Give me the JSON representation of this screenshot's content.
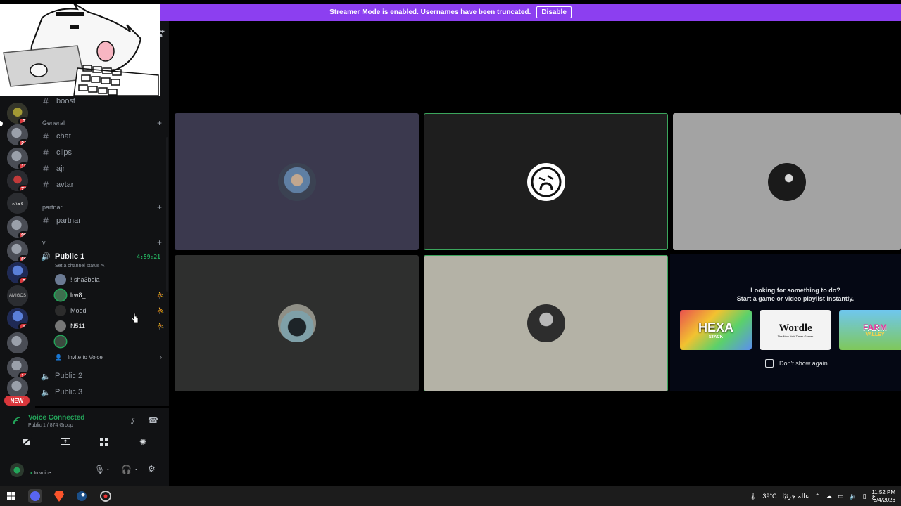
{
  "banner": {
    "text": "Streamer Mode is enabled. Usernames have been truncated.",
    "button": "Disable"
  },
  "servers": [
    {
      "badge": ""
    },
    {
      "badge": "2"
    },
    {
      "badge": "24"
    },
    {
      "badge": "11"
    },
    {
      "badge": "72"
    },
    {
      "badge": ""
    },
    {
      "badge": "95"
    },
    {
      "badge": "69"
    },
    {
      "badge": "7"
    },
    {
      "badge": ""
    },
    {
      "badge": "1"
    },
    {
      "badge": ""
    },
    {
      "badge": "14"
    }
  ],
  "server_rail": {
    "text_server": "قعده",
    "amigos_server": "AMIGOS",
    "new_label": "NEW"
  },
  "channels": {
    "top": "boost",
    "general_label": "General",
    "general": [
      "chat",
      "clips",
      "ajr",
      "avtar"
    ],
    "partnar_label": "partnar",
    "partnar": [
      "partnar"
    ],
    "v_label": "v",
    "voice_active": "Public 1",
    "voice_time": "4:59:21",
    "set_status": "Set a channel status",
    "members": [
      "! sha3bola",
      "lrw8_",
      "Mood",
      "N511",
      ""
    ],
    "invite": "Invite to Voice",
    "voice_other": [
      "Public 2",
      "Public 3"
    ]
  },
  "voice_panel": {
    "status": "Voice Connected",
    "sub": "Public 1 / 874 Group",
    "user_status": "In voice"
  },
  "activity": {
    "title_line1": "Looking for something to do?",
    "title_line2": "Start a game or video playlist instantly.",
    "games": [
      "HEXA",
      "Wordle",
      "FARM"
    ],
    "game_sub": [
      "STACK",
      "The New York Times Games",
      "VALLEY"
    ],
    "dont_show": "Don't show again"
  },
  "taskbar": {
    "weather": "39°C",
    "weather_desc": "عالم جزئيًا",
    "lang": "ع",
    "time": "11:52 PM",
    "date": "8/4/2026"
  },
  "icons": [
    "discord-icon",
    "add-friend-icon",
    "hash-icon",
    "speaker-icon",
    "pencil-icon",
    "stream-icon",
    "invite-icon",
    "chevron-right-icon",
    "signal-icon",
    "camera-off-icon",
    "screen-share-icon",
    "activities-icon",
    "soundboard-icon",
    "disconnect-icon",
    "mic-icon",
    "headset-icon",
    "settings-icon",
    "windows-icon",
    "brave-icon",
    "steam-icon",
    "chrome-icon"
  ],
  "colors": {
    "banner": "#8c3ff0",
    "speaking": "#3ba55c",
    "badge": "#da373c",
    "sidebar": "#111214"
  }
}
